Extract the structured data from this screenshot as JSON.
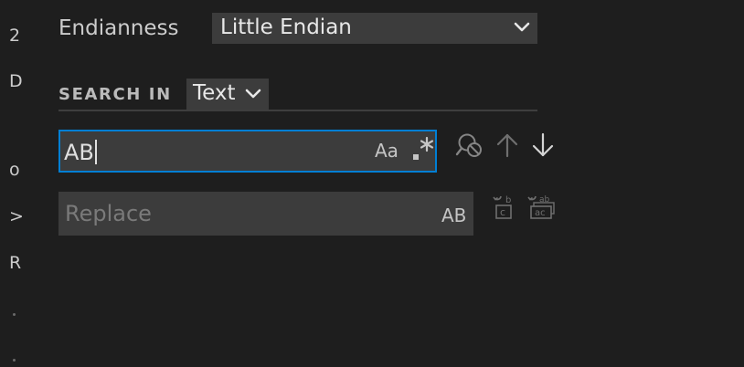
{
  "gutter": {
    "chars": [
      "2",
      "D",
      "o",
      ">",
      "R"
    ]
  },
  "endianness": {
    "label": "Endianness",
    "selected": "Little Endian"
  },
  "search_in": {
    "label": "SEARCH IN",
    "selected": "Text"
  },
  "find": {
    "value": "AB",
    "match_case_label": "Aa",
    "regex_label": ".*",
    "icons": [
      "clear-search-icon",
      "arrow-up-icon",
      "arrow-down-icon"
    ]
  },
  "replace": {
    "placeholder": "Replace",
    "preserve_case_label": "AB",
    "icons": [
      "replace-icon",
      "replace-all-icon"
    ]
  },
  "colors": {
    "background": "#1e1e1e",
    "input_background": "#3c3c3c",
    "focus_border": "#007fd4",
    "foreground": "#cccccc"
  }
}
